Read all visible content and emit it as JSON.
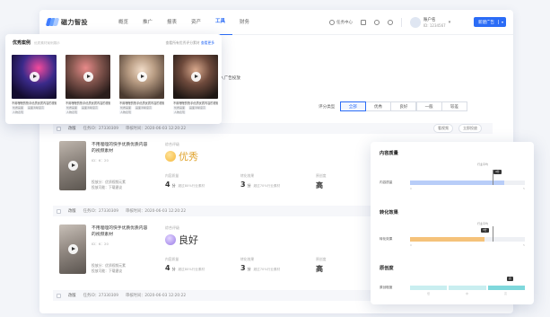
{
  "app": {
    "brand": "磁力智投",
    "nav": [
      "概览",
      "推广",
      "报表",
      "资产",
      "工具",
      "财务"
    ],
    "active_nav": 4,
    "top_right": {
      "task_center": "任务中心",
      "account_name": "账户名",
      "account_id": "ID: 1234567",
      "create_label": "新建广告"
    }
  },
  "page": {
    "hint": "入广告投放",
    "filter_label": "评分类型",
    "filter_options": [
      "全部",
      "优秀",
      "良好",
      "一般",
      "较差"
    ],
    "filter_selected": 0
  },
  "rows": [
    {
      "tag": "改版",
      "task_id": "任务ID：27330309",
      "time": "审核时间：2020-06-03 12:20:22",
      "ops": [
        "看视频",
        "立即投放"
      ],
      "title": "不用哩哩的快手优质优质内容的视频素材",
      "sub": "ID：6：20",
      "meta1": "投放分：优质视频元素",
      "meta2": "投放可能：下载建议",
      "grade_label": "综合评级",
      "grade": "优秀",
      "grade_color": "#f5b83b",
      "metrics": [
        {
          "k": "内容质量",
          "v": "4",
          "unit": "分",
          "extra": "超过80%行业素材"
        },
        {
          "k": "转化效果",
          "v": "3",
          "unit": "分",
          "extra": "超过70%行业素材"
        },
        {
          "k": "原创度",
          "v": "高",
          "unit": "",
          "extra": ""
        }
      ]
    },
    {
      "tag": "改版",
      "task_id": "任务ID：27330309",
      "time": "审核时间：2020-06-03 12:20:22",
      "ops": [],
      "title": "不用哩哩的快手优质优质内容的视频素材",
      "sub": "ID：6：20",
      "meta1": "投放分：优质视频元素",
      "meta2": "投放可能：下载建议",
      "grade_label": "综合评级",
      "grade": "良好",
      "grade_color": "#9a7be6",
      "metrics": [
        {
          "k": "内容质量",
          "v": "4",
          "unit": "分",
          "extra": "超过80%行业素材"
        },
        {
          "k": "转化效果",
          "v": "3",
          "unit": "分",
          "extra": "超过70%行业素材"
        },
        {
          "k": "原创度",
          "v": "高",
          "unit": "",
          "extra": ""
        }
      ]
    },
    {
      "tag": "改版",
      "task_id": "任务ID：27330309",
      "time": "审核时间：2020-06-03 12:20:22"
    }
  ],
  "examples": {
    "title": "优秀案例",
    "subtitle": "优质素材案例展示",
    "more_prefix": "查看所有优秀评分素材",
    "more_link": "查看更多",
    "cards": [
      {
        "caption": "不用哩哩的快手优质优质内容的视频",
        "tags": [
          "优质画面",
          "画面清晰度高",
          "人物表现"
        ]
      },
      {
        "caption": "不用哩哩的快手优质优质内容的视频",
        "tags": [
          "优质画面",
          "画面清晰度高",
          "人物表现"
        ]
      },
      {
        "caption": "不用哩哩的快手优质优质内容的视频",
        "tags": [
          "优质画面",
          "画面清晰度高",
          "人物表现"
        ]
      },
      {
        "caption": "不用哩哩的快手优质优质内容的视频",
        "tags": [
          "优质画面",
          "画面清晰度高",
          "人物表现"
        ]
      }
    ]
  },
  "analysis": {
    "quality": {
      "title": "内容质量",
      "row": "内容质量",
      "avg_label": "行业平均",
      "value_label": "4分",
      "fill": 0.82,
      "avg": 0.72,
      "ticks": [
        "0",
        "5"
      ]
    },
    "conversion": {
      "title": "转化效果",
      "row": "转化效果",
      "avg_label": "行业平均",
      "value_label": "3分",
      "fill": 0.65,
      "avg": 0.72,
      "ticks": [
        "0",
        "5"
      ]
    },
    "originality": {
      "title": "原创度",
      "row": "原创程度",
      "value_label": "高",
      "levels": [
        "低",
        "中",
        "高"
      ]
    }
  }
}
